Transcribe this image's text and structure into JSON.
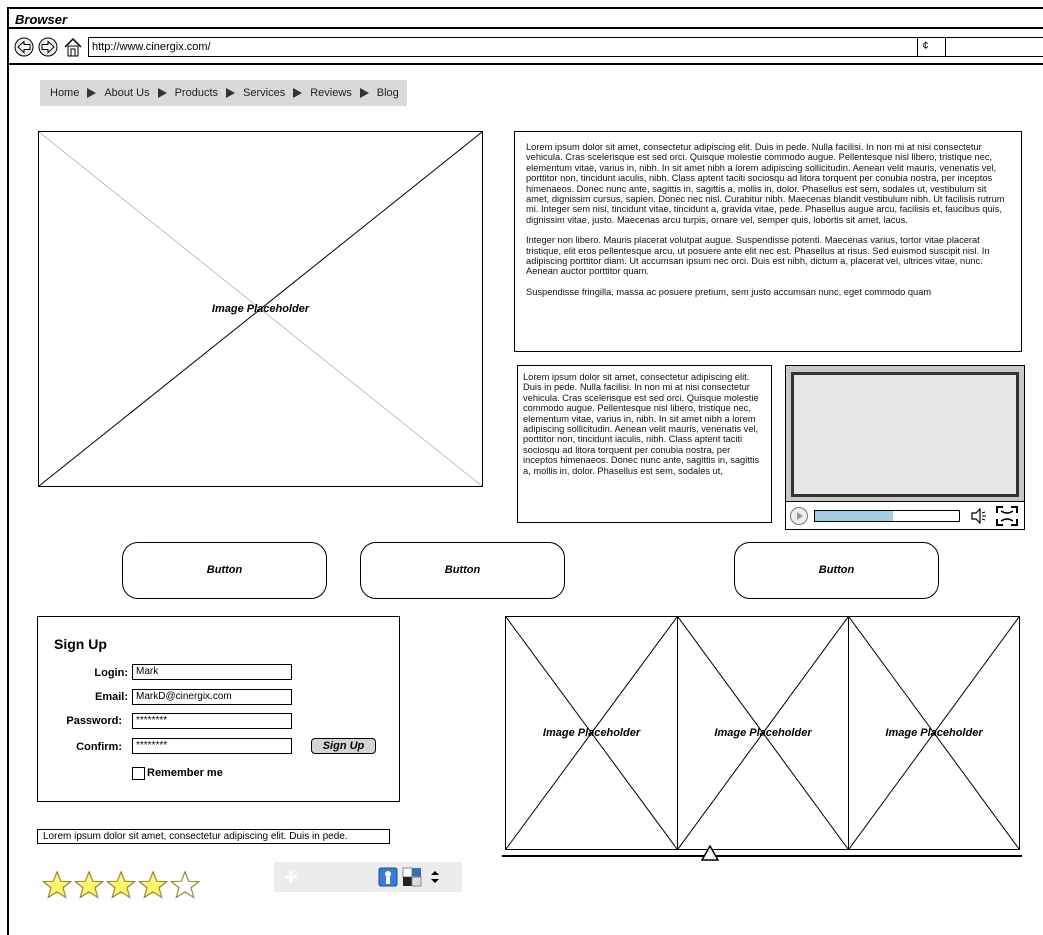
{
  "browser": {
    "title": "Browser",
    "url": "http://www.cinergix.com/",
    "refresh_label": "¢",
    "search_value": ""
  },
  "breadcrumb": {
    "items": [
      "Home",
      "About Us",
      "Products",
      "Services",
      "Reviews",
      "Blog"
    ]
  },
  "hero_image": {
    "label": "Image Placeholder"
  },
  "article": {
    "paragraphs": [
      "Lorem ipsum dolor sit amet, consectetur adipiscing elit. Duis in pede. Nulla facilisi. In non mi at nisi consectetur vehicula. Cras scelerisque est sed orci. Quisque molestie commodo augue. Pellentesque nisl libero, tristique nec, elementum vitae, varius in, nibh. In sit amet nibh a lorem adipiscing sollicitudin. Aenean velit mauris, venenatis vel, porttitor non, tincidunt iaculis, nibh. Class aptent taciti sociosqu ad litora torquent per conubia nostra, per inceptos himenaeos. Donec nunc ante, sagittis in, sagittis a, mollis in, dolor. Phasellus est sem, sodales ut, vestibulum sit amet, dignissim cursus, sapien. Donec nec nisl. Curabitur nibh. Maecenas blandit vestibulum nibh. Ut facilisis rutrum mi. Integer sem nisi, tincidunt vitae, tincidunt a, gravida vitae, pede. Phasellus augue arcu, facilisis et, faucibus quis, dignissim vitae, justo. Maecenas arcu turpis, ornare vel, semper quis, lobortis sit amet, lacus.",
      "Integer non libero. Mauris placerat volutpat augue. Suspendisse potenti. Maecenas varius, tortor vitae placerat tristique, elit eros pellentesque arcu, ut posuere ante elit nec est. Phasellus at risus. Sed euismod suscipit nisl. In adipiscing porttitor diam. Ut accumsan ipsum nec orci. Duis est nibh, dictum a, placerat vel, ultrices vitae, nunc. Aenean auctor porttitor quam.",
      "Suspendisse fringilla, massa ac posuere pretium, sem justo accumsan nunc, eget commodo quam"
    ]
  },
  "side_text": "Lorem ipsum dolor sit amet, consectetur adipiscing elit. Duis in pede. Nulla facilisi. In non mi at nisi consectetur vehicula. Cras scelerisque est sed orci. Quisque molestie commodo augue. Pellentesque nisl libero, tristique nec, elementum vitae, varius in, nibh. In sit amet nibh a lorem adipiscing sollicitudin. Aenean velit mauris, venenatis vel, porttitor non, tincidunt iaculis, nibh. Class aptent taciti sociosqu ad litora torquent per conubia nostra, per inceptos himenaeos. Donec nunc ante, sagittis in, sagittis a, mollis in, dolor. Phasellus est sem, sodales ut,",
  "video": {
    "progress": 0.54,
    "progress_color": "#a3cce6"
  },
  "buttons": [
    "Button",
    "Button",
    "Button"
  ],
  "signup": {
    "title": "Sign Up",
    "login_label": "Login:",
    "login_value": "Mark",
    "email_label": "Email:",
    "email_value": "MarkD@cinergix.com",
    "password_label": "Password:",
    "password_value": "********",
    "confirm_label": "Confirm:",
    "confirm_value": "********",
    "submit_label": "Sign Up",
    "remember_label": "Remember me"
  },
  "gallery": {
    "labels": [
      "Image Placeholder",
      "Image Placeholder",
      "Image Placeholder"
    ]
  },
  "footer_text": "Lorem ipsum dolor sit amet, consectetur adipiscing elit. Duis in pede.",
  "rating": {
    "value": 4,
    "max": 5,
    "star_color": "#fff56a"
  },
  "icons": [
    "back-arrow-icon",
    "forward-arrow-icon",
    "home-icon",
    "volume-icon",
    "fullscreen-icon",
    "plus-icon",
    "info-icon",
    "checker-icon",
    "sort-arrows-icon"
  ]
}
